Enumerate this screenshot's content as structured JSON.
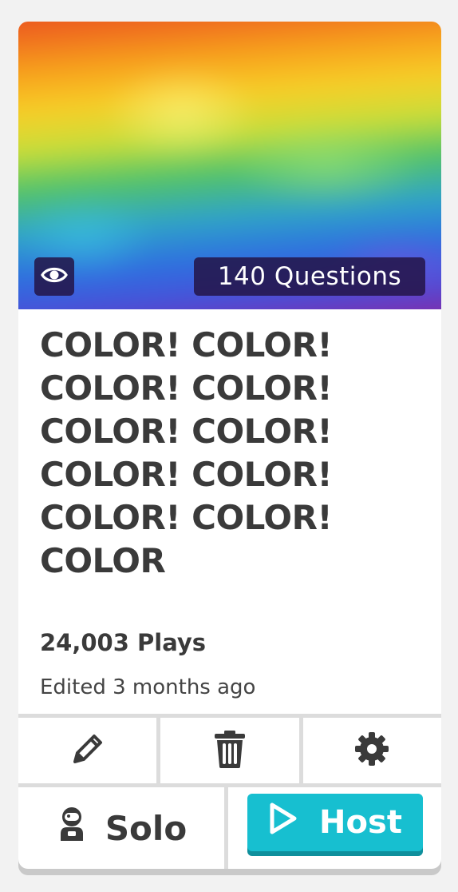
{
  "cover": {
    "question_count": "140 Questions",
    "view_icon": "eye-icon"
  },
  "title": "COLOR! COLOR! COLOR! COLOR! COLOR! COLOR! COLOR! COLOR! COLOR! COLOR! COLOR",
  "stats": {
    "plays": "24,003 Plays",
    "edited": "Edited 3 months ago"
  },
  "actions": {
    "edit_icon": "pencil-icon",
    "delete_icon": "trash-icon",
    "settings_icon": "gear-icon"
  },
  "play": {
    "solo_label": "Solo",
    "solo_icon": "astronaut-icon",
    "host_label": "Host",
    "host_icon": "play-icon",
    "host_color": "#17bfd0"
  }
}
